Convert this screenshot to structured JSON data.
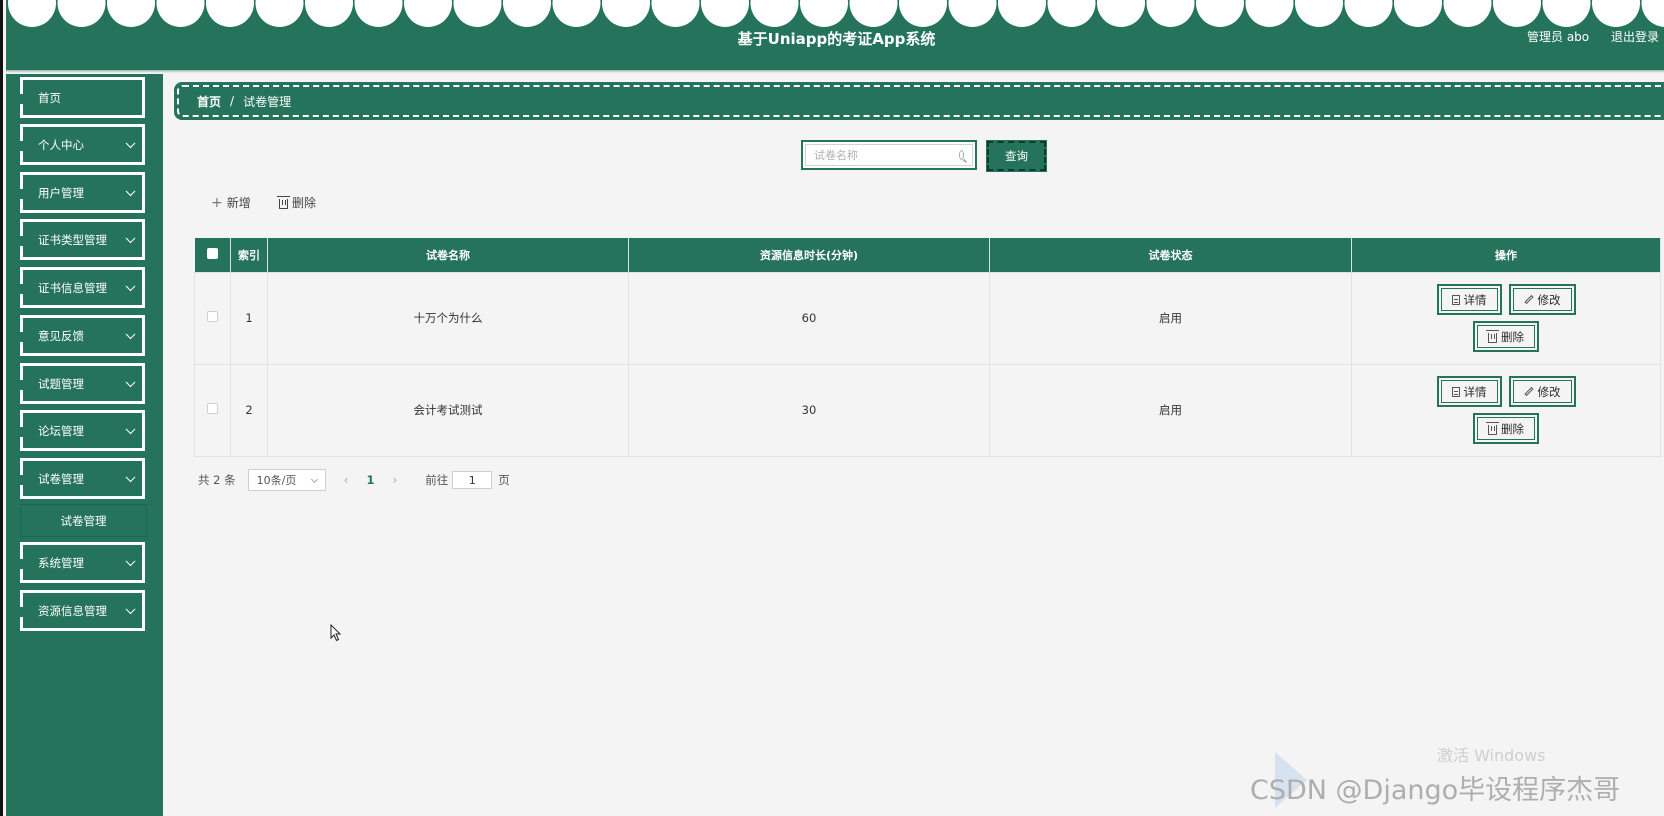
{
  "app": {
    "title": "基于Uniapp的考证App系统",
    "user_label": "管理员 abo",
    "logout_label": "退出登录",
    "accent_color": "#25735a"
  },
  "sidebar": {
    "items": [
      {
        "label": "首页",
        "has_children": false
      },
      {
        "label": "个人中心",
        "has_children": true
      },
      {
        "label": "用户管理",
        "has_children": true
      },
      {
        "label": "证书类型管理",
        "has_children": true
      },
      {
        "label": "证书信息管理",
        "has_children": true
      },
      {
        "label": "意见反馈",
        "has_children": true
      },
      {
        "label": "试题管理",
        "has_children": true
      },
      {
        "label": "论坛管理",
        "has_children": true
      },
      {
        "label": "试卷管理",
        "has_children": true,
        "expanded": true
      },
      {
        "label": "系统管理",
        "has_children": true
      },
      {
        "label": "资源信息管理",
        "has_children": true
      }
    ],
    "submenu": {
      "label": "试卷管理",
      "active": true
    }
  },
  "breadcrumb": {
    "home": "首页",
    "separator": "/",
    "current": "试卷管理"
  },
  "search": {
    "placeholder": "试卷名称",
    "value": "",
    "button_label": "查询"
  },
  "toolbar": {
    "add_label": "新增",
    "delete_label": "删除"
  },
  "table": {
    "columns": [
      "索引",
      "试卷名称",
      "资源信息时长(分钟)",
      "试卷状态",
      "操作"
    ],
    "rows": [
      {
        "index": "1",
        "name": "十万个为什么",
        "duration": "60",
        "status": "启用"
      },
      {
        "index": "2",
        "name": "会计考试测试",
        "duration": "30",
        "status": "启用"
      }
    ],
    "actions": {
      "detail": "详情",
      "edit": "修改",
      "delete": "删除"
    }
  },
  "pagination": {
    "total_text": "共 2 条",
    "page_size": "10条/页",
    "current_page": "1",
    "goto_label": "前往",
    "goto_value": "1",
    "page_unit": "页"
  },
  "watermarks": {
    "windows": "激活 Windows",
    "csdn": "CSDN @Django毕设程序杰哥"
  }
}
